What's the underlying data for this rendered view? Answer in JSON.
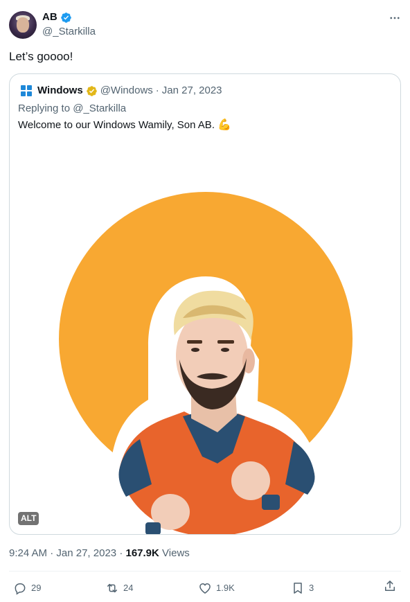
{
  "author": {
    "name": "AB",
    "handle": "@_Starkilla"
  },
  "tweet": {
    "text": "Let’s goooo!"
  },
  "quoted": {
    "name": "Windows",
    "handle": "@Windows",
    "separator": "·",
    "date": "Jan 27, 2023",
    "reply_line": "Replying to @_Starkilla",
    "text": "Welcome to our Windows Wamily, Son AB.",
    "emoji": "💪",
    "alt_label": "ALT"
  },
  "meta": {
    "time": "9:24 AM",
    "separator": "·",
    "date": "Jan 27, 2023",
    "views_count": "167.9K",
    "views_label": "Views"
  },
  "actions": {
    "replies": "29",
    "reposts": "24",
    "likes": "1.9K",
    "bookmarks": "3"
  },
  "colors": {
    "accent_blue": "#1d9bf0",
    "gold_badge": "#e2b719",
    "muted_text": "#536471",
    "orange_circle": "#f8a832"
  },
  "icons": [
    "verified-badge-icon",
    "more-icon",
    "windows-logo-icon",
    "gold-badge-icon",
    "reply-icon",
    "repost-icon",
    "like-icon",
    "bookmark-icon",
    "share-icon"
  ]
}
